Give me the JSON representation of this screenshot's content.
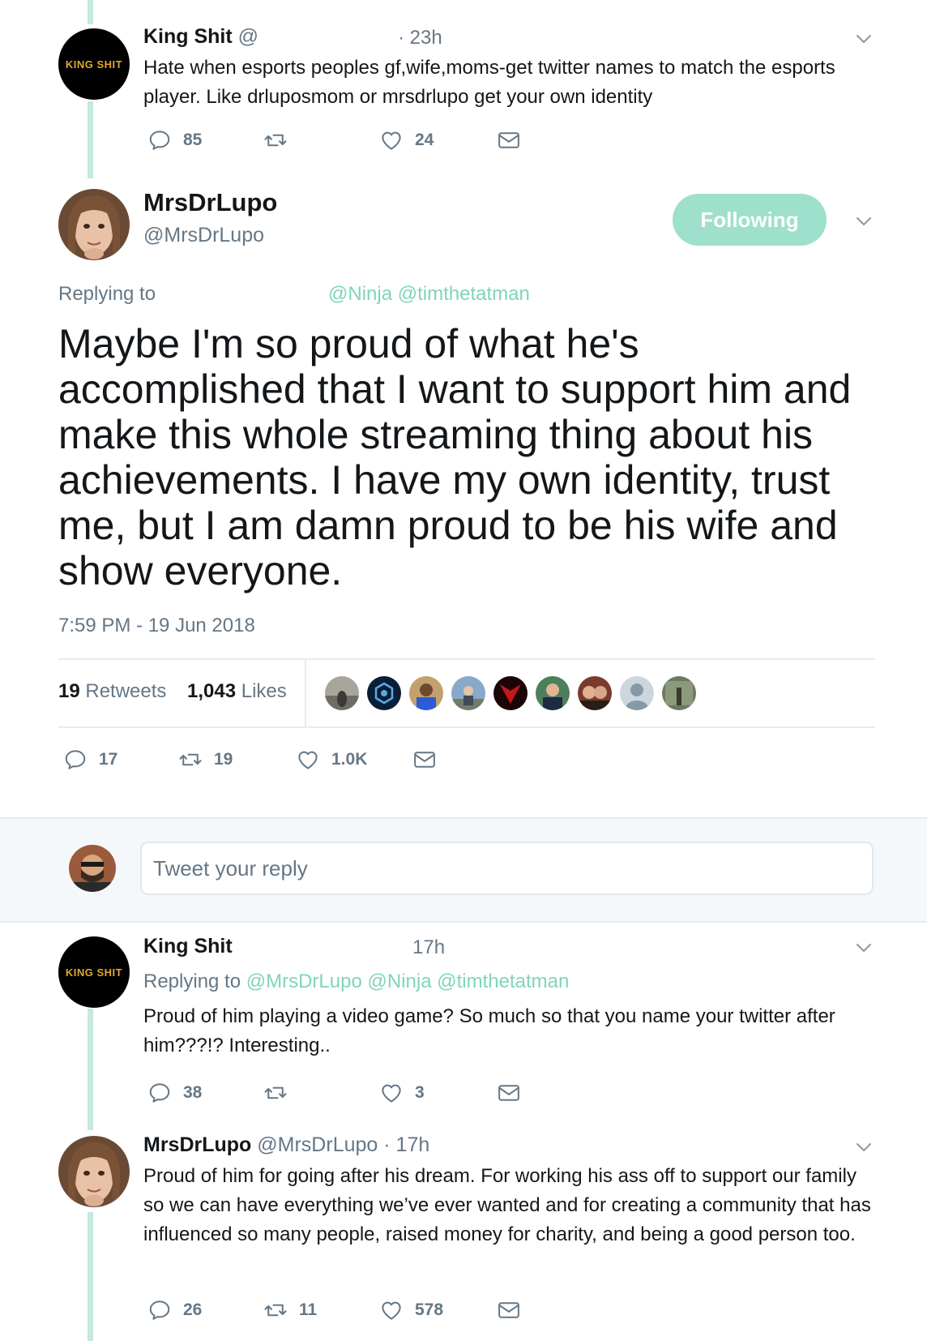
{
  "tweet1": {
    "name": "King Shit",
    "handle": "@",
    "time": "· 23h",
    "avatar_text": "KING SHIT",
    "text": "Hate when esports peoples gf,wife,moms-get twitter names to match the esports player. Like drluposmom or mrsdrlupo get your own identity",
    "replies": "85",
    "retweets": "",
    "likes": "24"
  },
  "main": {
    "name": "MrsDrLupo",
    "handle": "@MrsDrLupo",
    "follow_label": "Following",
    "replying_label": "Replying to",
    "replying_handles": "@Ninja @timthetatman",
    "text": "Maybe I'm so proud of what he's accomplished that I want to support him and make this whole streaming thing about his achievements. I have my own identity, trust me, but I am damn proud to be his wife and show everyone.",
    "timestamp": "7:59 PM - 19 Jun 2018",
    "retweets_count": "19",
    "retweets_label": "Retweets",
    "likes_count": "1,043",
    "likes_label": "Likes",
    "replies": "17",
    "retweets": "19",
    "likes": "1.0K"
  },
  "reply_box": {
    "placeholder": "Tweet your reply"
  },
  "tweet3": {
    "name": "King Shit",
    "time": "17h",
    "avatar_text": "KING SHIT",
    "replying_label": "Replying to",
    "replying_handles": "@MrsDrLupo @Ninja @timthetatman",
    "text": "Proud of him playing a video game? So much so that you name your twitter after him???!? Interesting..",
    "replies": "38",
    "retweets": "",
    "likes": "3"
  },
  "tweet4": {
    "name": "MrsDrLupo",
    "handle": "@MrsDrLupo",
    "time": "· 17h",
    "text": "Proud of him for going after his dream. For working his ass off to support our family so we can have everything we’ve ever wanted and for creating a community that has influenced so many people, raised money for charity, and being a good person too.",
    "replies": "26",
    "retweets": "11",
    "likes": "578"
  },
  "colors": {
    "accent": "#7fd5bb",
    "follow_button": "#9ee0cb",
    "gray_text": "#657786",
    "thread_line": "#c4e9dd"
  }
}
